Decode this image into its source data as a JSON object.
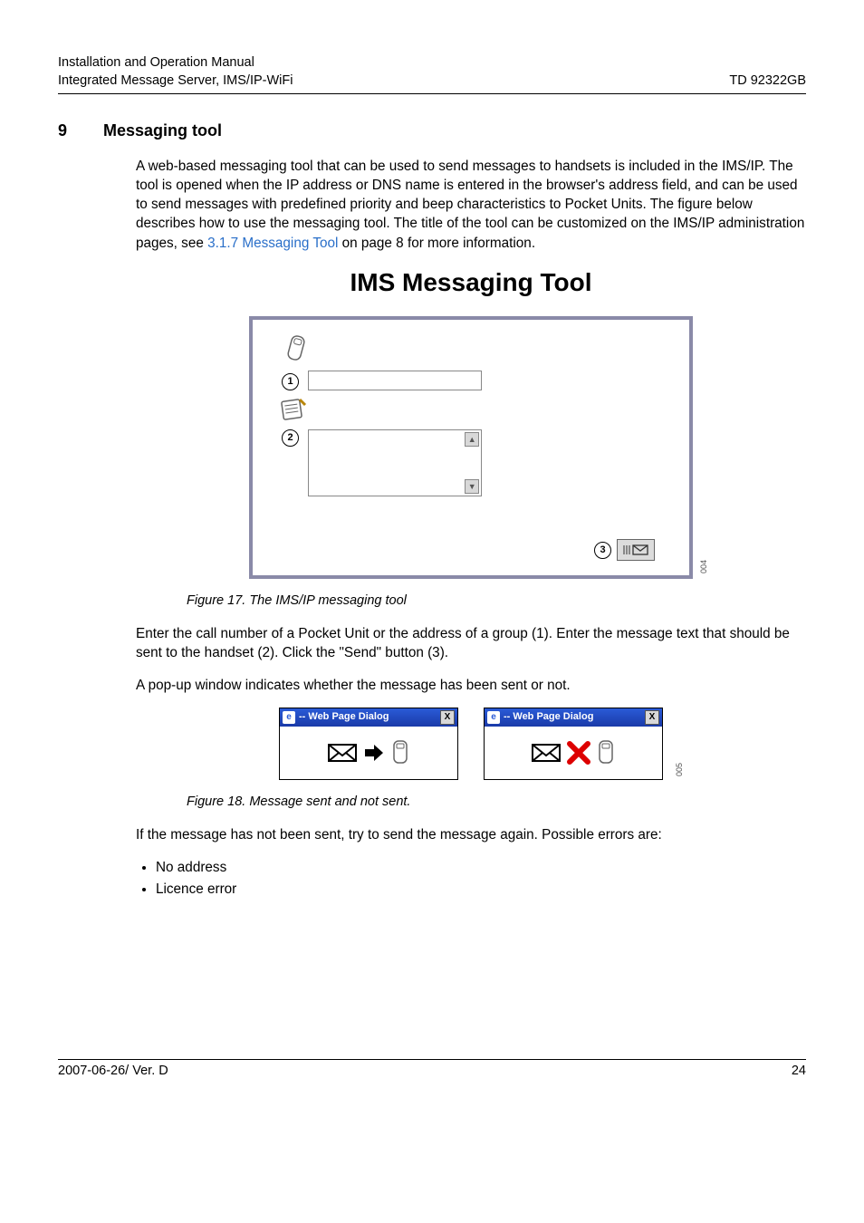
{
  "header": {
    "line1": "Installation and Operation Manual",
    "line2_left": "Integrated Message Server, IMS/IP-WiFi",
    "line2_right": "TD 92322GB"
  },
  "section": {
    "num": "9",
    "title": "Messaging tool"
  },
  "intro": {
    "text_a": "A web-based messaging tool that can be used to send messages to handsets is included in the IMS/IP. The tool is opened when the IP address or DNS name is entered in the browser's address field, and can be used to send messages with predefined priority and beep characteristics to Pocket Units. The figure below describes how to use the messaging tool. The title of the tool can be customized on the IMS/IP administration pages, see ",
    "link_a": "3.1.7 Messaging Tool",
    "text_b": " on page 8 for more information."
  },
  "figure17": {
    "title": "IMS Messaging Tool",
    "callout1": "1",
    "callout2": "2",
    "callout3": "3",
    "img_id": "004",
    "caption": "Figure 17. The IMS/IP messaging tool"
  },
  "para2": "Enter the call number of a Pocket Unit or the address of a group (1). Enter the message text that should be sent to the handset (2). Click the \"Send\" button (3).",
  "para3": "A pop-up window indicates whether the message has been sent or not.",
  "figure18": {
    "dlg_title": "-- Web Page Dialog",
    "img_id": "005",
    "caption": "Figure 18. Message sent and not sent."
  },
  "para4": "If the message has not been sent, try to send the message again. Possible errors are:",
  "bullets": [
    "No address",
    "Licence error"
  ],
  "footer": {
    "left": "2007-06-26/ Ver. D",
    "right": "24"
  }
}
